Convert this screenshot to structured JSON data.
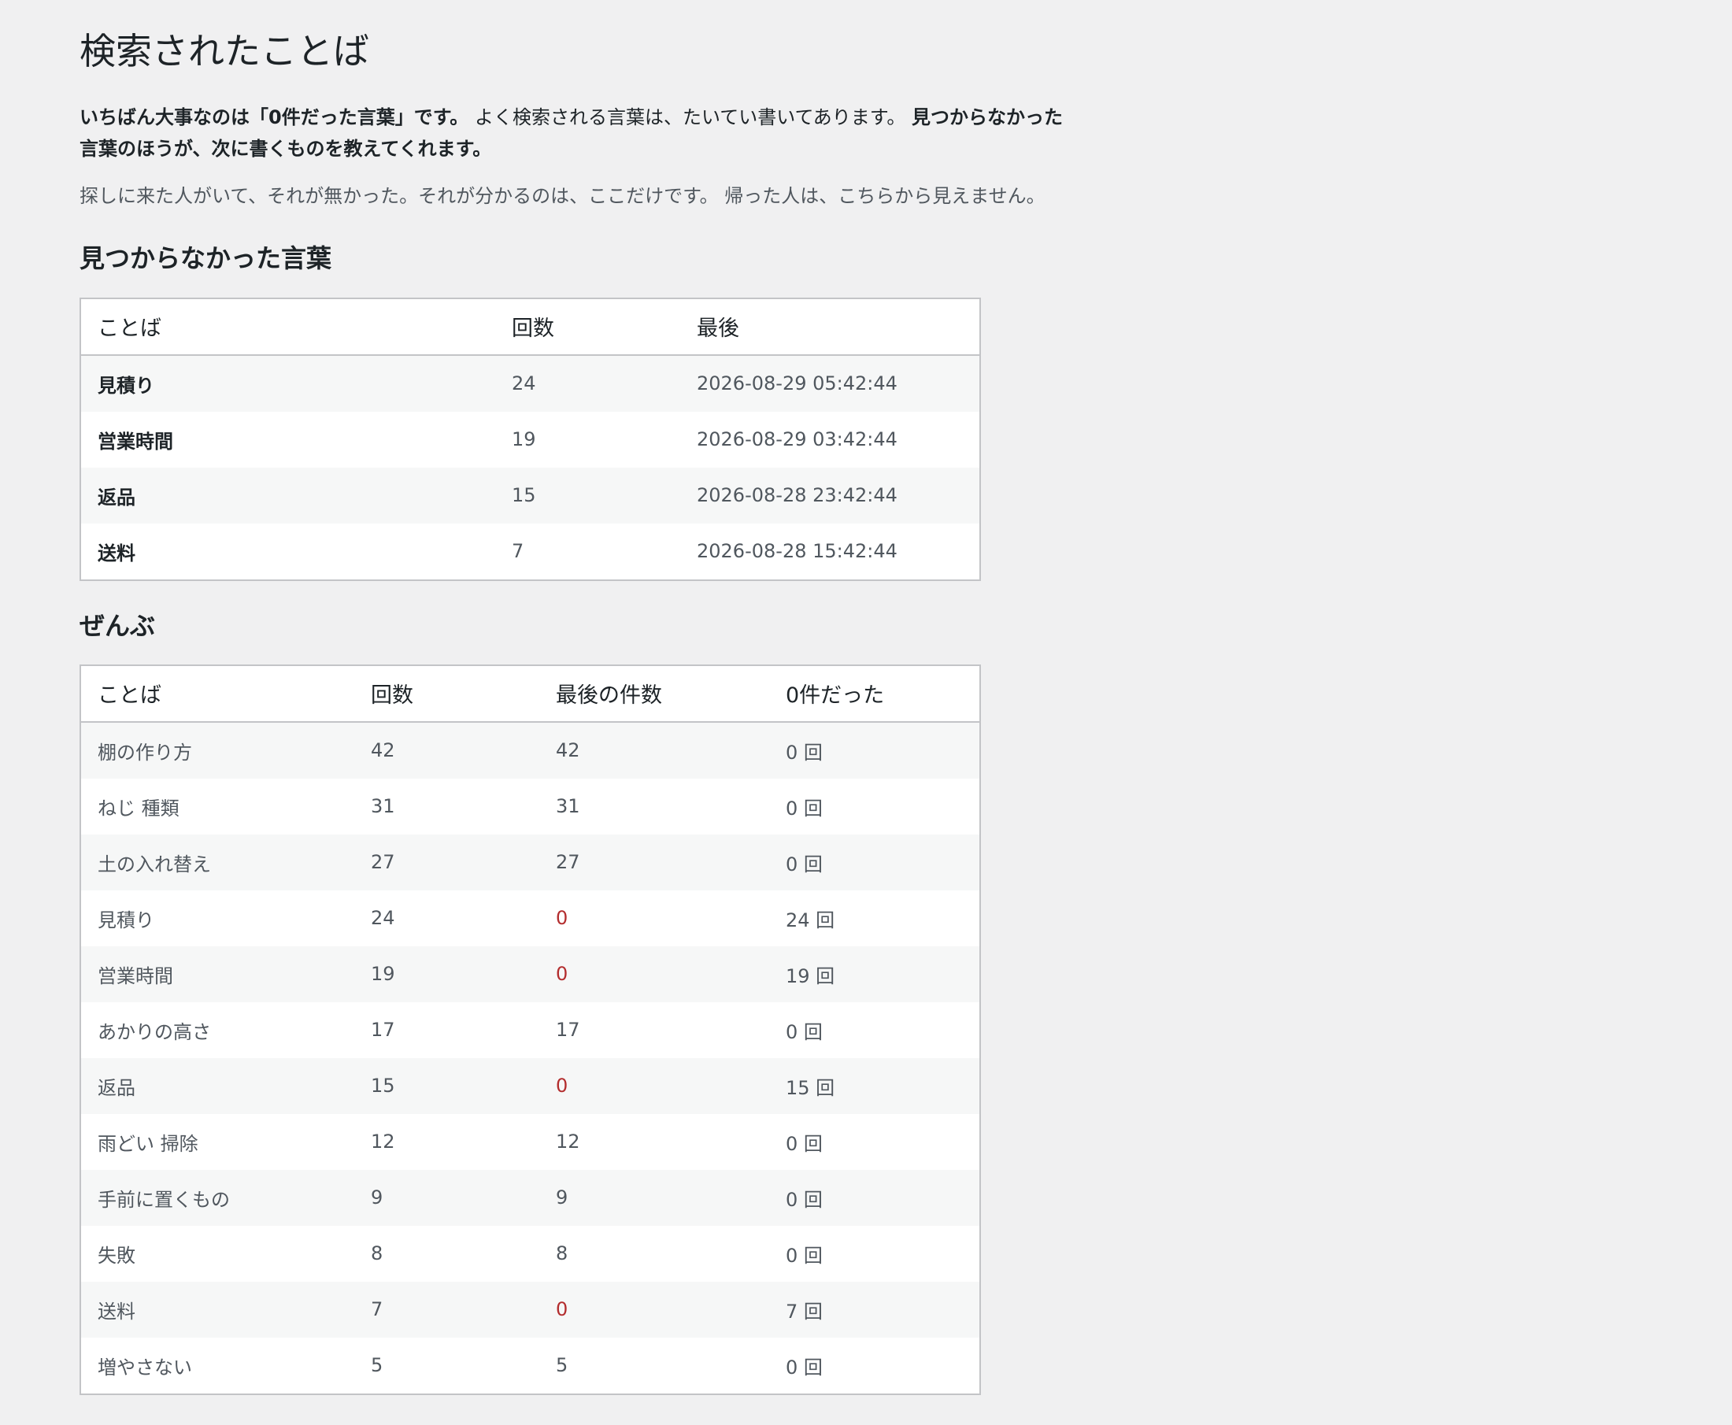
{
  "page": {
    "title": "検索されたことば"
  },
  "intro": {
    "lead_bold_1": "いちばん大事なのは「0件だった言葉」です。",
    "lead_normal": " よく検索される言葉は、たいてい書いてあります。 ",
    "lead_bold_2": "見つからなかった言葉のほうが、次に書くものを教えてくれます。",
    "note": "探しに来た人がいて、それが無かった。それが分かるのは、ここだけです。 帰った人は、こちらから見えません。"
  },
  "not_found": {
    "heading": "見つからなかった言葉",
    "columns": [
      "ことば",
      "回数",
      "最後"
    ],
    "rows": [
      {
        "word": "見積り",
        "count": "24",
        "last": "2026-08-29 05:42:44"
      },
      {
        "word": "営業時間",
        "count": "19",
        "last": "2026-08-29 03:42:44"
      },
      {
        "word": "返品",
        "count": "15",
        "last": "2026-08-28 23:42:44"
      },
      {
        "word": "送料",
        "count": "7",
        "last": "2026-08-28 15:42:44"
      }
    ]
  },
  "all": {
    "heading": "ぜんぶ",
    "columns": [
      "ことば",
      "回数",
      "最後の件数",
      "0件だった"
    ],
    "rows": [
      {
        "word": "棚の作り方",
        "count": "42",
        "last_results": "42",
        "zero": "0 回",
        "is_zero": false
      },
      {
        "word": "ねじ 種類",
        "count": "31",
        "last_results": "31",
        "zero": "0 回",
        "is_zero": false
      },
      {
        "word": "土の入れ替え",
        "count": "27",
        "last_results": "27",
        "zero": "0 回",
        "is_zero": false
      },
      {
        "word": "見積り",
        "count": "24",
        "last_results": "0",
        "zero": "24 回",
        "is_zero": true
      },
      {
        "word": "営業時間",
        "count": "19",
        "last_results": "0",
        "zero": "19 回",
        "is_zero": true
      },
      {
        "word": "あかりの高さ",
        "count": "17",
        "last_results": "17",
        "zero": "0 回",
        "is_zero": false
      },
      {
        "word": "返品",
        "count": "15",
        "last_results": "0",
        "zero": "15 回",
        "is_zero": true
      },
      {
        "word": "雨どい 掃除",
        "count": "12",
        "last_results": "12",
        "zero": "0 回",
        "is_zero": false
      },
      {
        "word": "手前に置くもの",
        "count": "9",
        "last_results": "9",
        "zero": "0 回",
        "is_zero": false
      },
      {
        "word": "失敗",
        "count": "8",
        "last_results": "8",
        "zero": "0 回",
        "is_zero": false
      },
      {
        "word": "送料",
        "count": "7",
        "last_results": "0",
        "zero": "7 回",
        "is_zero": true
      },
      {
        "word": "増やさない",
        "count": "5",
        "last_results": "5",
        "zero": "0 回",
        "is_zero": false
      }
    ]
  },
  "colors": {
    "zero_result": "#b32d2e",
    "background": "#f0f0f1",
    "stripe": "#f6f7f7"
  }
}
